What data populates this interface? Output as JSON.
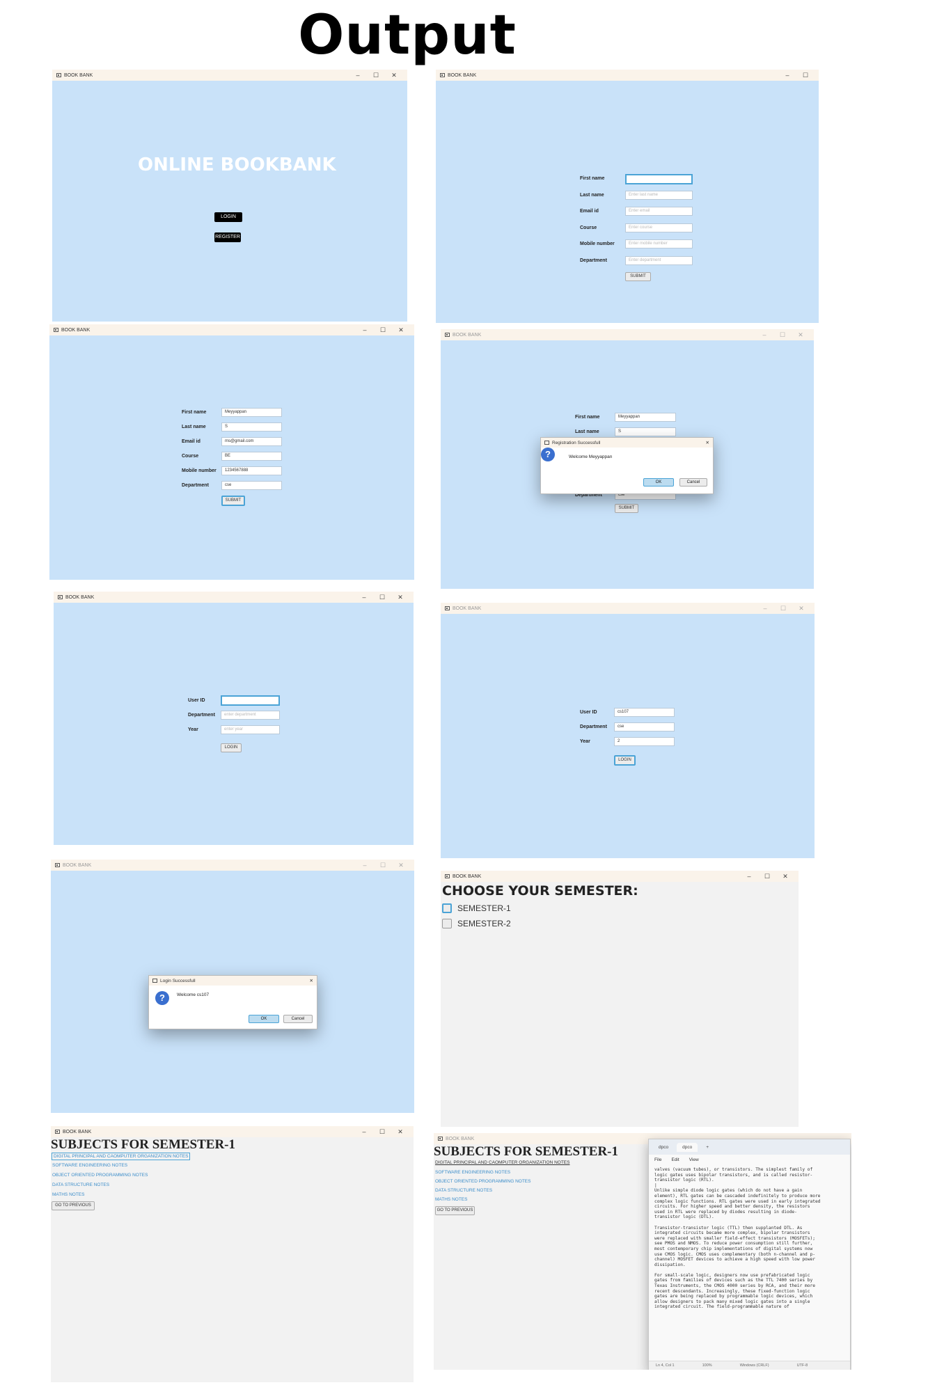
{
  "heading": "Output",
  "window_title": "BOOK BANK",
  "window_controls": {
    "minimize": "–",
    "maximize": "☐",
    "close": "✕"
  },
  "home": {
    "title": "ONLINE BOOKBANK",
    "login": "LOGIN",
    "register": "REGISTER"
  },
  "register_form": {
    "labels": [
      "First name",
      "Last name",
      "Email id",
      "Course",
      "Mobile number",
      "Department"
    ],
    "placeholders": [
      "",
      "Enter last name",
      "Enter email",
      "Enter course",
      "Enter mobile number",
      "Enter department"
    ],
    "values": [
      "Meyyappan",
      "S",
      "ms@gmail.com",
      "BE",
      "1234567888",
      "cse"
    ],
    "submit": "SUBMIT"
  },
  "reg_dialog": {
    "title": "Registration Successfull",
    "message": "Welcome Meyyappan",
    "ok": "OK",
    "cancel": "Cancel",
    "bg_first_value": "Meyyappan",
    "bg_second_value": "S",
    "bg_dept_value": "cse"
  },
  "login_form": {
    "labels": [
      "User ID",
      "Department",
      "Year"
    ],
    "placeholders": [
      "",
      "enter department",
      "enter year"
    ],
    "values": [
      "cs107",
      "cse",
      "2"
    ],
    "login": "LOGIN"
  },
  "login_dialog": {
    "title": "Login Successfull",
    "message": "Welcome cs107",
    "ok": "OK",
    "cancel": "Cancel"
  },
  "semester": {
    "heading": "CHOOSE YOUR SEMESTER:",
    "options": [
      "SEMESTER-1",
      "SEMESTER-2"
    ]
  },
  "subjects": {
    "heading": "SUBJECTS FOR SEMESTER-1",
    "links": [
      "DIGITAL PRINCIPAL AND CAOMPUTER ORGANIZATION NOTES",
      "SOFTWARE ENGINEERING NOTES",
      "OBJECT ORIENTED PROGRAMMING NOTES",
      "DATA STRUCTURE NOTES",
      "MATHS NOTES"
    ],
    "back": "GO TO PREVIOUS"
  },
  "notepad": {
    "tabs": [
      "dpco",
      "dpco"
    ],
    "menu": [
      "File",
      "Edit",
      "View"
    ],
    "text": "valves (vacuum tubes), or transistors. The simplest family of\nlogic gates uses bipolar transistors, and is called resistor-\ntransistor logic (RTL).\n|\nUnlike simple diode logic gates (which do not have a gain\nelement), RTL gates can be cascaded indefinitely to produce more\ncomplex logic functions. RTL gates were used in early integrated\ncircuits. For higher speed and better density, the resistors\nused in RTL were replaced by diodes resulting in diode-\ntransistor logic (DTL).\n\nTransistor-transistor logic (TTL) then supplanted DTL. As\nintegrated circuits became more complex, bipolar transistors\nwere replaced with smaller field-effect transistors (MOSFETs);\nsee PMOS and NMOS. To reduce power consumption still further,\nmost contemporary chip implementations of digital systems now\nuse CMOS logic. CMOS uses complementary (both n-channel and p-\nchannel) MOSFET devices to achieve a high speed with low power\ndissipation.\n\nFor small-scale logic, designers now use prefabricated logic\ngates from families of devices such as the TTL 7400 series by\nTexas Instruments, the CMOS 4000 series by RCA, and their more\nrecent descendants. Increasingly, these fixed-function logic\ngates are being replaced by programmable logic devices, which\nallow designers to pack many mixed logic gates into a single\nintegrated circuit. The field-programmable nature of",
    "status": [
      "Ln 4, Col 1",
      "100%",
      "Windows (CRLF)",
      "UTF-8"
    ]
  },
  "colors": {
    "form_bg": "#c9e2f9",
    "gray_bg": "#f2f2f2",
    "focus": "#4aa3d6",
    "link": "#3a8cc9"
  }
}
